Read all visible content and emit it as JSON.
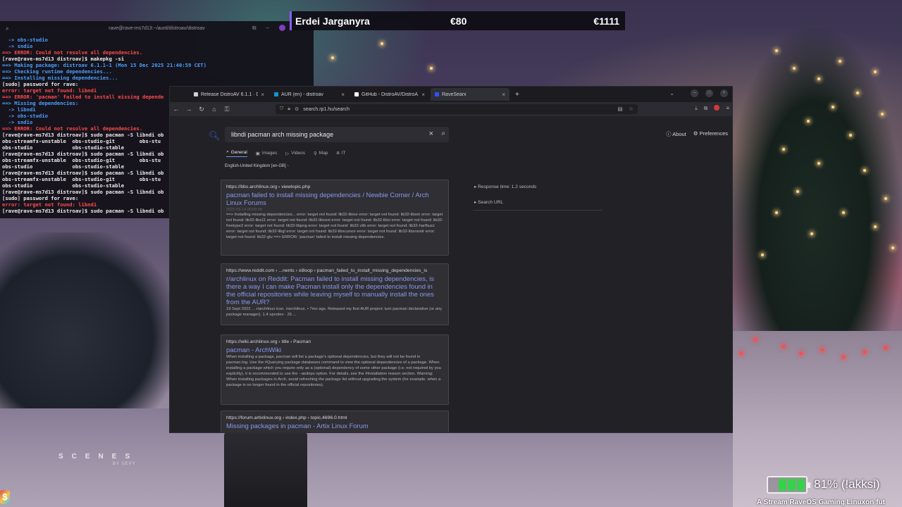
{
  "overlay": {
    "player_name": "Erdei Jarganyra",
    "value_1": "€80",
    "value_2": "€1111",
    "scenes_label": "SCENES",
    "scenes_by": "BY SEVY",
    "battery_text": "81% (!akksi)",
    "battery_level_percent": 81,
    "ticker": "A Stream RaveOS Gaming Linuxon fut",
    "dollar_icon": "$"
  },
  "terminal": {
    "title": "rave@rave-ms7d13:~/aurd/distroav/distroav",
    "lines": [
      {
        "text": "  -> obs-studio",
        "cls": "arrow"
      },
      {
        "text": "  -> sndio",
        "cls": "arrow"
      },
      {
        "text": "==> ERROR: Could not resolve all dependencies.",
        "cls": "err"
      },
      {
        "text": "[rave@rave-ms7d13 distroav]$ makepkg -si",
        "cls": ""
      },
      {
        "text": "==> Making package: distroav 6.1.1-1 (Mon 15 Dec 2025 21:40:59 CET)",
        "cls": "ok"
      },
      {
        "text": "==> Checking runtime dependencies...",
        "cls": "ok"
      },
      {
        "text": "==> Installing missing dependencies...",
        "cls": "ok"
      },
      {
        "text": "[sudo] password for rave:",
        "cls": ""
      },
      {
        "text": "error: target not found: libndi",
        "cls": "err"
      },
      {
        "text": "==> ERROR: 'pacman' failed to install missing depende",
        "cls": "err"
      },
      {
        "text": "==> Missing dependencies:",
        "cls": "ok"
      },
      {
        "text": "  -> libndi",
        "cls": "arrow"
      },
      {
        "text": "  -> obs-studio",
        "cls": "arrow"
      },
      {
        "text": "  -> sndio",
        "cls": "arrow"
      },
      {
        "text": "==> ERROR: Could not resolve all dependencies.",
        "cls": "err"
      },
      {
        "text": "[rave@rave-ms7d13 distroav]$ sudo pacman -S libndi ob",
        "cls": ""
      },
      {
        "text": "obs-streamfx-unstable  obs-studio-git        obs-stu",
        "cls": ""
      },
      {
        "text": "obs-studio             obs-studio-stable",
        "cls": ""
      },
      {
        "text": "[rave@rave-ms7d13 distroav]$ sudo pacman -S libndi ob",
        "cls": ""
      },
      {
        "text": "obs-streamfx-unstable  obs-studio-git        obs-stu",
        "cls": ""
      },
      {
        "text": "obs-studio             obs-studio-stable",
        "cls": ""
      },
      {
        "text": "[rave@rave-ms7d13 distroav]$ sudo pacman -S libndi ob",
        "cls": ""
      },
      {
        "text": "obs-streamfx-unstable  obs-studio-git        obs-stu",
        "cls": ""
      },
      {
        "text": "obs-studio             obs-studio-stable",
        "cls": ""
      },
      {
        "text": "[rave@rave-ms7d13 distroav]$ sudo pacman -S libndi ob",
        "cls": ""
      },
      {
        "text": "[sudo] password for rave:",
        "cls": ""
      },
      {
        "text": "error: target not found: libndi",
        "cls": "err"
      },
      {
        "text": "[rave@rave-ms7d13 distroav]$ sudo pacman -S libndi ob",
        "cls": ""
      }
    ]
  },
  "browser": {
    "tabs": [
      {
        "label": "Release DistroAV 6.1.1 · D",
        "icon_color": "#d0d0d0"
      },
      {
        "label": "AUR (en) - distroav",
        "icon_color": "#1793d1"
      },
      {
        "label": "GitHub - DistroAV/DistroA",
        "icon_color": "#ffffff"
      },
      {
        "label": "RaveSearx",
        "icon_color": "#3050ff"
      }
    ],
    "url": "search.rp1.hu/search",
    "search_query": "libndi pacman arch missing package",
    "about_label": "About",
    "preferences_label": "Preferences",
    "categories": [
      "General",
      "Images",
      "Videos",
      "Map",
      "IT"
    ],
    "locale": "English-United Kingdom [en-GB]",
    "sidebar": {
      "response_time": "Response time: 1.2 seconds",
      "search_url": "Search URL"
    },
    "results": [
      {
        "url": "https://bbs.archlinux.org › viewtopic.php",
        "title": "pacman failed to install missing dependencies / Newbie Corner / Arch Linux Forums",
        "date": "2022-03-14 00:00:00",
        "snippet": "==> Installing missing dependencies... error: target not found: lib32-libice error: target not found: lib32-libsm error: target not found: lib32-libx11 error: target not found: lib32-libxext error: target not found: lib32-libxi error: target not found: lib32-freetype2 error: target not found: lib32-libpng error: target not found: lib32-zlib error: target not found: lib32-harfbuzz error: target not found: lib32-libgl error: target not found: lib32-libxcursor error: target not found: lib32-libxrandr error: target not found: lib32-glu ==> ERROR: 'pacman' failed to install missing dependencies."
      },
      {
        "url": "https://www.reddit.com › ...nents › xi8oop › pacman_failed_to_install_missing_dependencies_is",
        "title": "r/archlinux on Reddit: Pacman failed to install missing dependencies, is there a way I can make Pacman install only the dependencies found in the official repositories while leaving myself to manually install the ones from the AUR?",
        "date": "",
        "snippet": "19 Sept 2022 ... r/archlinux icon. r/archlinux. • 7mo ago. Released my first AUR project: turn pacman declarative (or any package manager). 1.4 upvotes · 25 ..."
      },
      {
        "url": "https://wiki.archlinux.org › title › Pacman",
        "title": "pacman - ArchWiki",
        "date": "",
        "snippet": "When installing a package, pacman will list a package's optional dependencies, but they will not be found in pacman.log. Use the #Querying package databases command to view the optional dependencies of a package. When installing a package which you require only as a (optional) dependency of some other package (i.e. not required by you explicitly), it is recommended to use the --asdeps option. For details, see the #Installation reason section. Warning: When installing packages in Arch, avoid refreshing the package list without upgrading the system (for example, when a package is no longer found in the official repositories)."
      },
      {
        "url": "https://forum.artixlinux.org › index.php › topic,4696.0.html",
        "title": "Missing packages in pacman - Artix Linux Forum",
        "date": "",
        "snippet": ""
      }
    ]
  }
}
